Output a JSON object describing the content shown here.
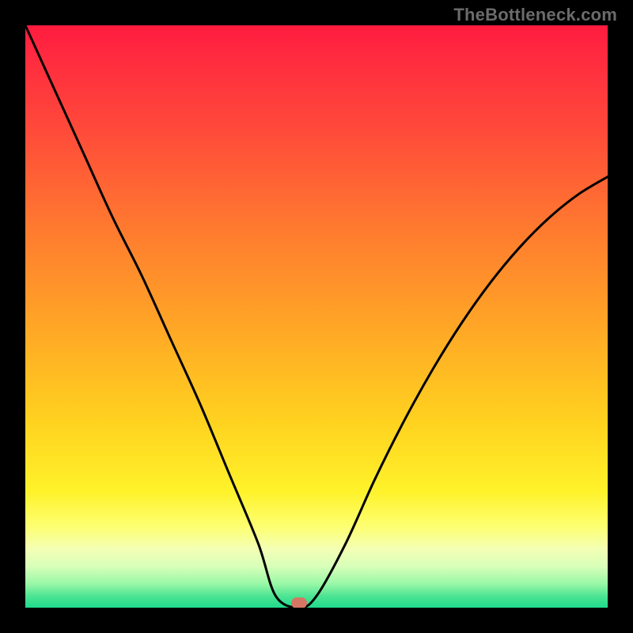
{
  "watermark": {
    "text": "TheBottleneck.com"
  },
  "colors": {
    "frame": "#000000",
    "curve": "#000000",
    "marker": "#d47663",
    "gradient_stops": [
      "#ff1a3e",
      "#ff2740",
      "#ff4a3a",
      "#ff7a2f",
      "#ffa726",
      "#ffd21f",
      "#fff22a",
      "#fdff70",
      "#f3ffb5",
      "#d7ffb9",
      "#96f7a6",
      "#4de493",
      "#1fd98c"
    ]
  },
  "chart_data": {
    "type": "line",
    "title": "",
    "xlabel": "",
    "ylabel": "",
    "xlim": [
      0,
      100
    ],
    "ylim": [
      0,
      100
    ],
    "curve": {
      "x": [
        0,
        5,
        10,
        15,
        20,
        25,
        30,
        35,
        40,
        43,
        47,
        50,
        55,
        60,
        65,
        70,
        75,
        80,
        85,
        90,
        95,
        100
      ],
      "percent": [
        100,
        89,
        78,
        67,
        57,
        46,
        35,
        23,
        11,
        2,
        0,
        2,
        11,
        22,
        32,
        41,
        49,
        56,
        62,
        67,
        71,
        74
      ]
    },
    "flat_minimum": {
      "x_start": 43,
      "x_end": 48,
      "percent": 0
    },
    "marker": {
      "x": 47,
      "percent": 0
    },
    "annotations": [],
    "grid": false,
    "legend": false
  }
}
